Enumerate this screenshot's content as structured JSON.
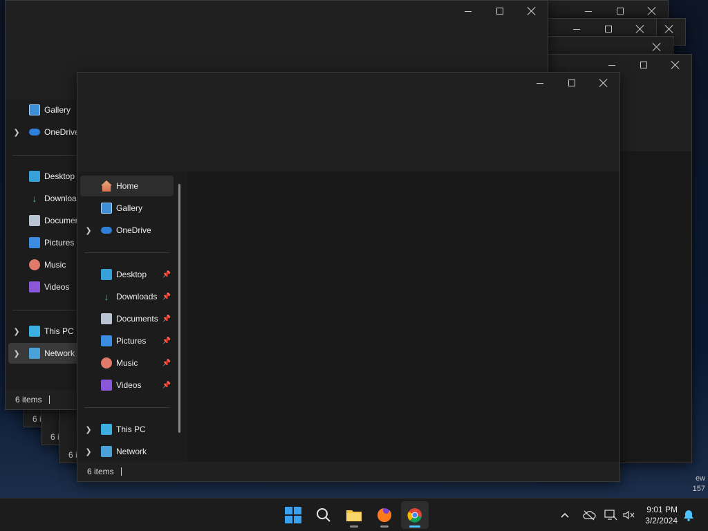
{
  "desktop": {
    "right_text_1": "ew",
    "right_text_2": "157"
  },
  "back_window": {
    "nav_items": [
      {
        "label": "Gallery",
        "icon": "gallery-icon"
      },
      {
        "label": "OneDrive",
        "icon": "cloud-icon"
      },
      {
        "label": "Desktop",
        "icon": "desktop-icon"
      },
      {
        "label": "Downloa",
        "icon": "download-icon"
      },
      {
        "label": "Documer",
        "icon": "document-icon"
      },
      {
        "label": "Pictures",
        "icon": "pictures-icon"
      },
      {
        "label": "Music",
        "icon": "music-icon"
      },
      {
        "label": "Videos",
        "icon": "videos-icon"
      },
      {
        "label": "This PC",
        "icon": "pc-icon"
      },
      {
        "label": "Network",
        "icon": "network-icon"
      }
    ],
    "status": "6 items"
  },
  "stacked_status": [
    "6 i",
    "6 i",
    "6 i"
  ],
  "front_window": {
    "nav_items": [
      {
        "label": "Home",
        "selected": true
      },
      {
        "label": "Gallery"
      },
      {
        "label": "OneDrive"
      },
      {
        "label": "Desktop",
        "pinned": true
      },
      {
        "label": "Downloads",
        "pinned": true
      },
      {
        "label": "Documents",
        "pinned": true
      },
      {
        "label": "Pictures",
        "pinned": true
      },
      {
        "label": "Music",
        "pinned": true
      },
      {
        "label": "Videos",
        "pinned": true
      },
      {
        "label": "This PC"
      },
      {
        "label": "Network"
      }
    ],
    "status": "6 items"
  },
  "taskbar": {
    "apps": [
      "start-icon",
      "search-icon",
      "file-explorer-icon",
      "firefox-icon",
      "chrome-icon"
    ],
    "clock_time": "9:01 PM",
    "clock_date": "3/2/2024"
  },
  "colors": {
    "accent": "#4cc2ff",
    "window_bg": "#202020",
    "taskbar_bg": "#1c1c1c"
  }
}
